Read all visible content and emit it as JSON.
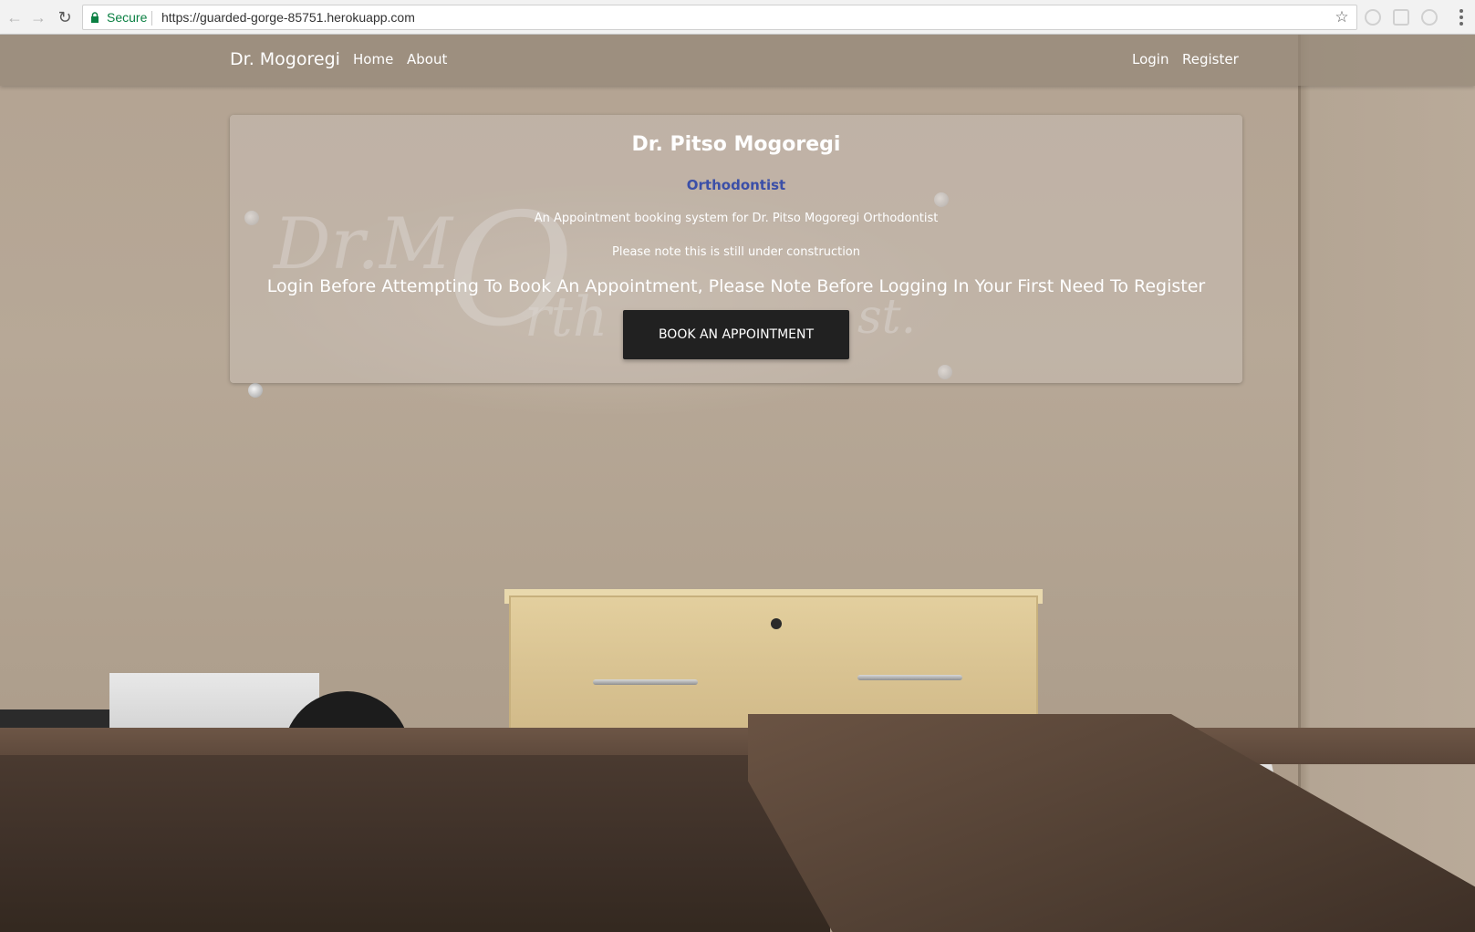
{
  "browser": {
    "secure_label": "Secure",
    "url": "https://guarded-gorge-85751.herokuapp.com",
    "icons": {
      "back": "back-arrow-icon",
      "forward": "forward-arrow-icon",
      "reload": "reload-icon",
      "lock": "lock-icon",
      "bookmark": "star-icon",
      "menu": "kebab-menu-icon"
    }
  },
  "navbar": {
    "brand": "Dr. Mogoregi",
    "left_links": [
      "Home",
      "About"
    ],
    "right_links": [
      "Login",
      "Register"
    ]
  },
  "hero": {
    "title": "Dr. Pitso Mogoregi",
    "subtitle": "Orthodontist",
    "description": "An Appointment booking system for Dr. Pitso Mogoregi Orthodontist",
    "note": "Please note this is still under construction",
    "warning": "Login Before Attempting To Book An Appointment, Please Note Before Logging In Your First Need To Register",
    "button_label": "BOOK AN APPOINTMENT"
  },
  "colors": {
    "subtitle": "#3b4fa8",
    "button_bg": "#212121",
    "secure_green": "#0b8043"
  }
}
